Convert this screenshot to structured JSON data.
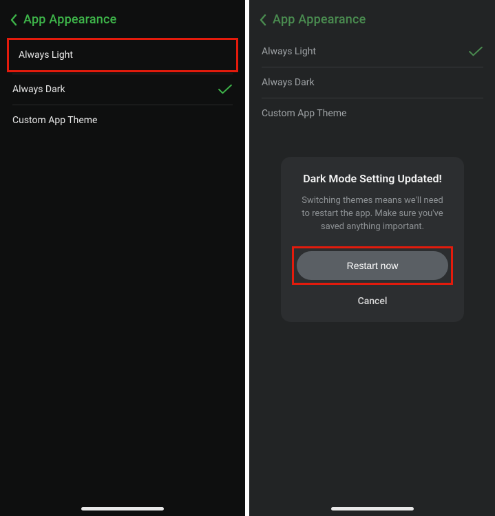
{
  "left": {
    "header": {
      "title": "App Appearance"
    },
    "options": [
      {
        "label": "Always Light",
        "selected": false,
        "highlighted": true
      },
      {
        "label": "Always Dark",
        "selected": true,
        "highlighted": false
      },
      {
        "label": "Custom App Theme",
        "selected": false,
        "highlighted": false
      }
    ]
  },
  "right": {
    "header": {
      "title": "App Appearance"
    },
    "options": [
      {
        "label": "Always Light",
        "selected": true,
        "highlighted": false
      },
      {
        "label": "Always Dark",
        "selected": false,
        "highlighted": false
      },
      {
        "label": "Custom App Theme",
        "selected": false,
        "highlighted": false
      }
    ],
    "modal": {
      "title": "Dark Mode Setting Updated!",
      "body": "Switching themes means we'll need to restart the app. Make sure you've saved anything important.",
      "primary": "Restart now",
      "secondary": "Cancel"
    }
  },
  "colors": {
    "accent_left": "#3eb64a",
    "accent_right": "#4a8c50",
    "highlight": "#e31b0c"
  }
}
